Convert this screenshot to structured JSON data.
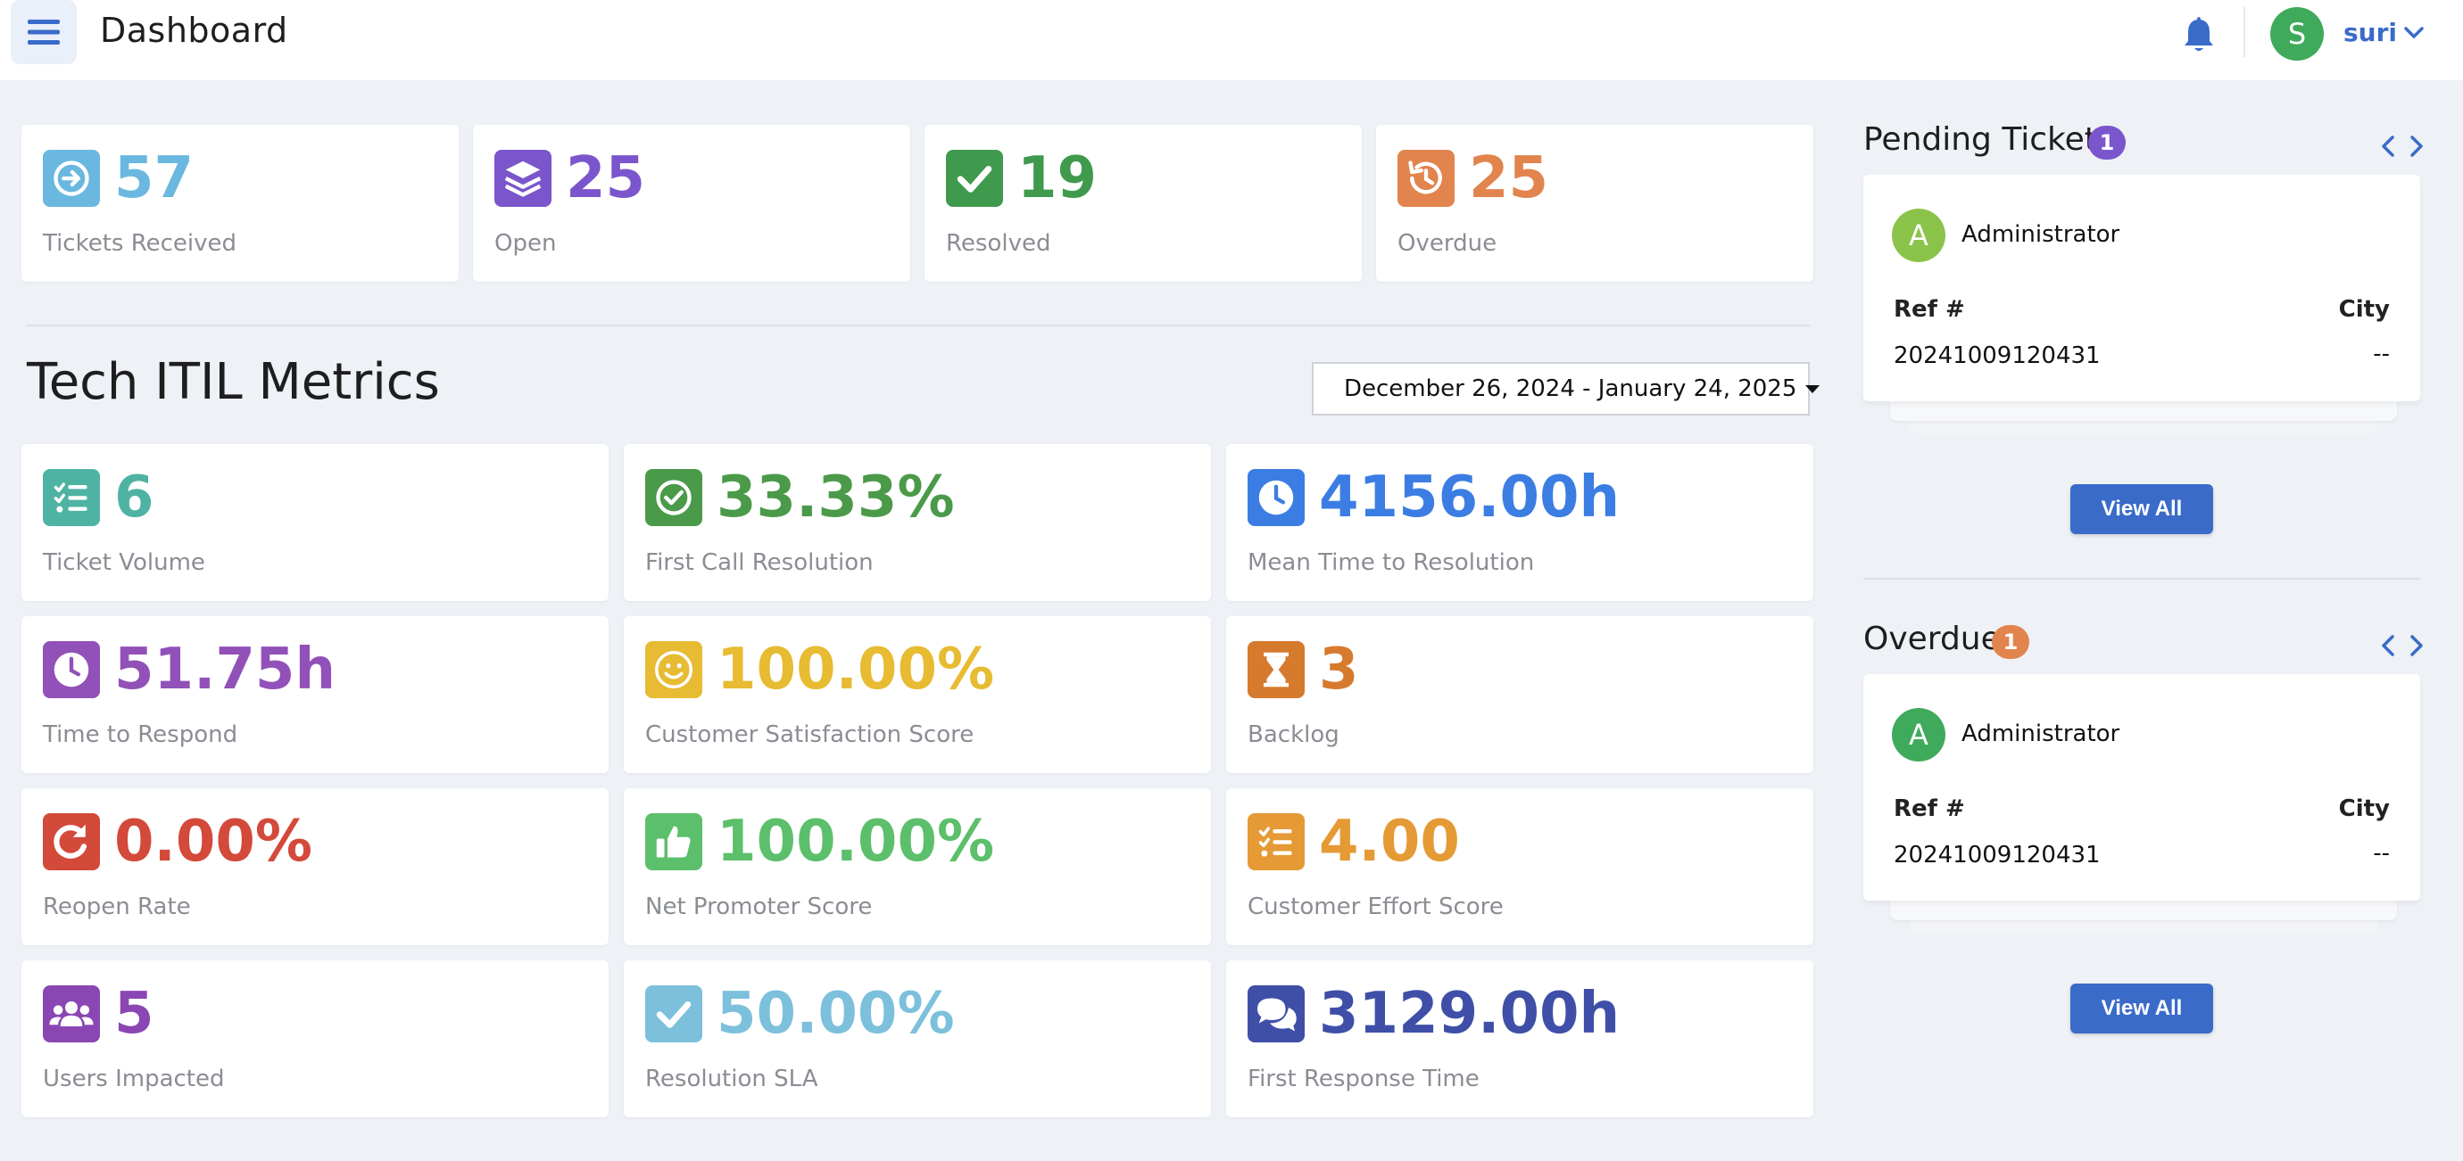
{
  "header": {
    "title": "Dashboard",
    "user": {
      "initial": "S",
      "name": "suri",
      "avatar_color": "#3faa5b",
      "name_color": "#3a6bc9"
    },
    "accent": "#3a6bc9",
    "icons": {
      "menu": "hamburger-icon",
      "notifications": "bell-icon",
      "user_menu": "chevron-down-icon"
    }
  },
  "summary": [
    {
      "value": "57",
      "label": "Tickets Received",
      "color": "#6ab8df",
      "icon": "arrow-circle-right-icon"
    },
    {
      "value": "25",
      "label": "Open",
      "color": "#7b55cc",
      "icon": "layers-icon"
    },
    {
      "value": "19",
      "label": "Resolved",
      "color": "#3f9a4e",
      "icon": "check-square-icon"
    },
    {
      "value": "25",
      "label": "Overdue",
      "color": "#e2844d",
      "icon": "history-icon"
    }
  ],
  "metrics": {
    "title": "Tech ITIL Metrics",
    "date_range": "December 26, 2024 - January 24, 2025",
    "cards": [
      {
        "value": "6",
        "label": "Ticket Volume",
        "color": "#4fb3a3",
        "icon": "list-check-icon"
      },
      {
        "value": "33.33%",
        "label": "First Call Resolution",
        "color": "#4a9a49",
        "icon": "check-circle-icon"
      },
      {
        "value": "4156.00h",
        "label": "Mean Time to Resolution",
        "color": "#3b7de3",
        "icon": "clock-icon"
      },
      {
        "value": "51.75h",
        "label": "Time to Respond",
        "color": "#9151b8",
        "icon": "clock-icon"
      },
      {
        "value": "100.00%",
        "label": "Customer Satisfaction Score",
        "color": "#e7bb32",
        "icon": "smile-icon"
      },
      {
        "value": "3",
        "label": "Backlog",
        "color": "#d67a2e",
        "icon": "hourglass-icon"
      },
      {
        "value": "0.00%",
        "label": "Reopen Rate",
        "color": "#d3493a",
        "icon": "redo-icon"
      },
      {
        "value": "100.00%",
        "label": "Net Promoter Score",
        "color": "#5cbf6b",
        "icon": "thumbs-up-icon"
      },
      {
        "value": "4.00",
        "label": "Customer Effort Score",
        "color": "#e59a35",
        "icon": "list-check-icon"
      },
      {
        "value": "5",
        "label": "Users Impacted",
        "color": "#8a47b3",
        "icon": "users-icon"
      },
      {
        "value": "50.00%",
        "label": "Resolution SLA",
        "color": "#7cc0dc",
        "icon": "check-square-icon"
      },
      {
        "value": "3129.00h",
        "label": "First Response Time",
        "color": "#3f4fa8",
        "icon": "comments-icon"
      }
    ]
  },
  "pending": {
    "title": "Pending Tickets",
    "count": "1",
    "badge_color": "#7b55cc",
    "ticket": {
      "initial": "A",
      "name": "Administrator",
      "avatar_color": "#8bc34a",
      "ref_header": "Ref #",
      "city_header": "City",
      "ref": "20241009120431",
      "city": "--"
    },
    "view_all": "View All"
  },
  "overdue": {
    "title": "Overdue",
    "count": "1",
    "badge_color": "#e2844d",
    "ticket": {
      "initial": "A",
      "name": "Administrator",
      "avatar_color": "#3faa5b",
      "ref_header": "Ref #",
      "city_header": "City",
      "ref": "20241009120431",
      "city": "--"
    },
    "view_all": "View All"
  }
}
